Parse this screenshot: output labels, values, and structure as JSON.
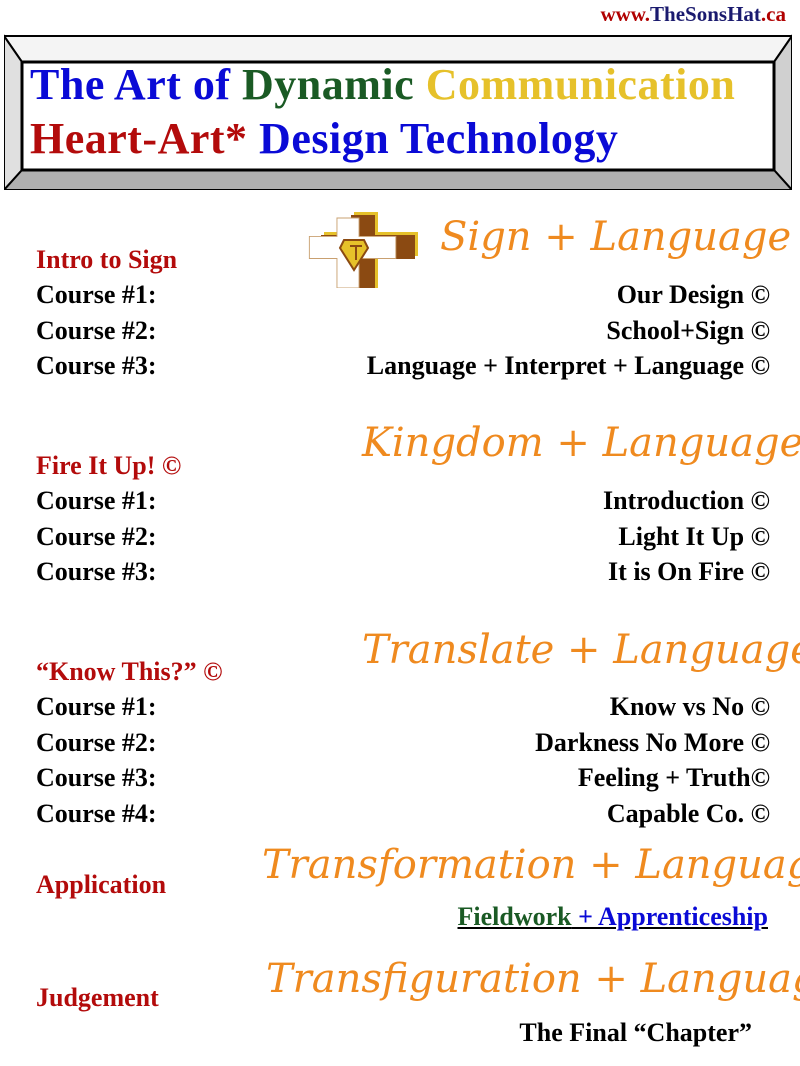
{
  "header": {
    "url_prefix": "www.",
    "url_brand": "TheSonsHat",
    "url_suffix": ".ca",
    "title_line1": {
      "part1": "The Art of ",
      "part2": "Dynamic ",
      "part3": "Communication"
    },
    "title_line2": {
      "part1": "Heart-Art* ",
      "part2": "Design Technology"
    }
  },
  "sections": [
    {
      "script_title": "Sign + Language",
      "label": "Intro to Sign",
      "courses": [
        {
          "num": "Course #1:",
          "name": "Our Design ©"
        },
        {
          "num": "Course #2:",
          "name": "School+Sign ©"
        },
        {
          "num": "Course #3:",
          "name": "Language + Interpret + Language ©"
        }
      ]
    },
    {
      "script_title": "Kingdom + Language",
      "label": "Fire It Up! ©",
      "courses": [
        {
          "num": "Course #1:",
          "name": "Introduction ©"
        },
        {
          "num": "Course #2:",
          "name": "Light It Up ©"
        },
        {
          "num": "Course #3:",
          "name": "It is On Fire ©"
        }
      ]
    },
    {
      "script_title": "Translate + Language",
      "label": "“Know This?” ©",
      "courses": [
        {
          "num": "Course #1:",
          "name": "Know vs No ©"
        },
        {
          "num": "Course #2:",
          "name": "Darkness No More ©"
        },
        {
          "num": "Course #3:",
          "name": "Feeling + Truth©"
        },
        {
          "num": "Course #4:",
          "name": "Capable Co. ©"
        }
      ]
    },
    {
      "script_title": "Transformation + Language",
      "label": "Application",
      "link_part1": "Fieldwork",
      "link_sep": " + ",
      "link_part2": "Apprenticeship"
    },
    {
      "script_title": "Transfiguration + Language",
      "label": "Judgement",
      "detail": "The Final “Chapter”"
    }
  ],
  "colors": {
    "accent_orange": "#ef8a1f",
    "label_red": "#b30b0b",
    "title_blue": "#0a0ad6",
    "title_green": "#1a5a24",
    "title_gold": "#e6c12a"
  }
}
